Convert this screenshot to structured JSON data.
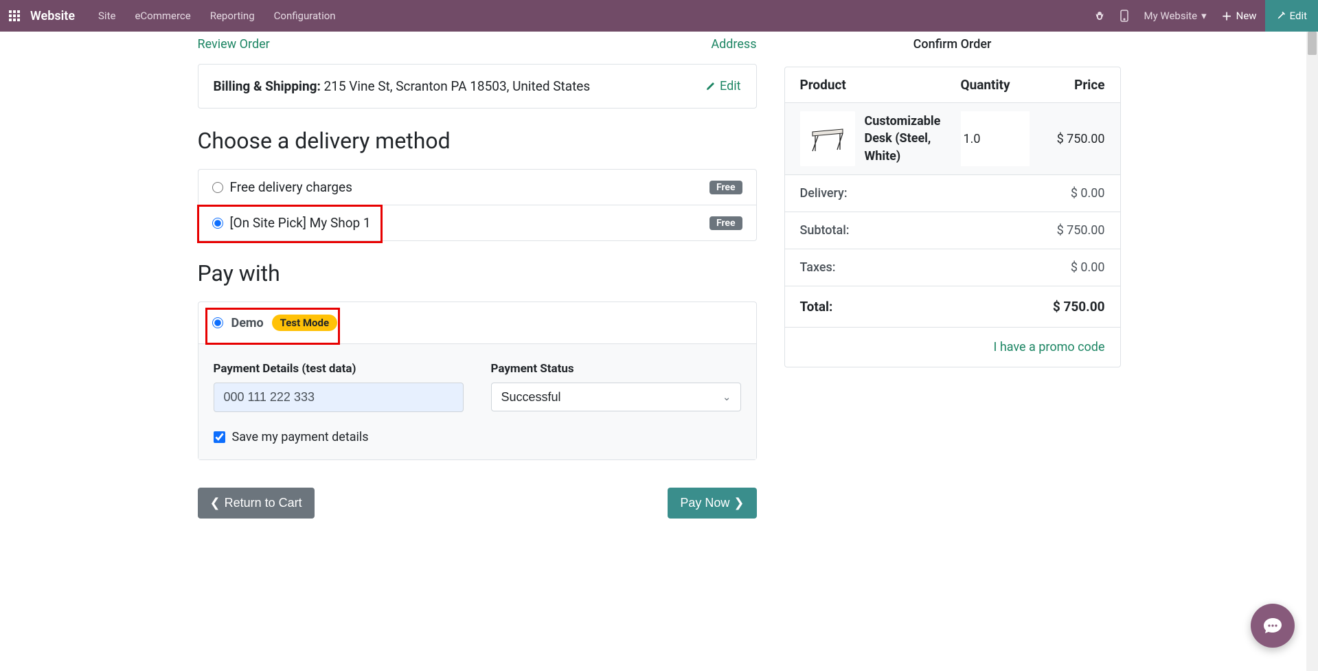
{
  "nav": {
    "brand": "Website",
    "items": [
      "Site",
      "eCommerce",
      "Reporting",
      "Configuration"
    ],
    "website_label": "My Website",
    "new": "New",
    "edit": "Edit"
  },
  "steps": {
    "review": "Review Order",
    "address": "Address",
    "confirm": "Confirm Order"
  },
  "address": {
    "label": "Billing & Shipping:",
    "value": "215 Vine St, Scranton PA 18503, United States",
    "edit": "Edit"
  },
  "delivery": {
    "heading": "Choose a delivery method",
    "options": [
      {
        "label": "Free delivery charges",
        "badge": "Free",
        "selected": false
      },
      {
        "label": "[On Site Pick] My Shop 1",
        "badge": "Free",
        "selected": true
      }
    ]
  },
  "payment": {
    "heading": "Pay with",
    "provider": "Demo",
    "test_badge": "Test Mode",
    "details_label": "Payment Details (test data)",
    "details_value": "000 111 222 333",
    "status_label": "Payment Status",
    "status_value": "Successful",
    "save_label": "Save my payment details",
    "save_checked": true
  },
  "buttons": {
    "return": "Return to Cart",
    "pay": "Pay Now"
  },
  "summary": {
    "headers": {
      "product": "Product",
      "qty": "Quantity",
      "price": "Price"
    },
    "item": {
      "name": "Customizable Desk (Steel, White)",
      "qty": "1.0",
      "price": "$ 750.00"
    },
    "lines": {
      "delivery": {
        "label": "Delivery:",
        "value": "$ 0.00"
      },
      "subtotal": {
        "label": "Subtotal:",
        "value": "$ 750.00"
      },
      "taxes": {
        "label": "Taxes:",
        "value": "$ 0.00"
      },
      "total": {
        "label": "Total:",
        "value": "$ 750.00"
      }
    },
    "promo": "I have a promo code"
  }
}
